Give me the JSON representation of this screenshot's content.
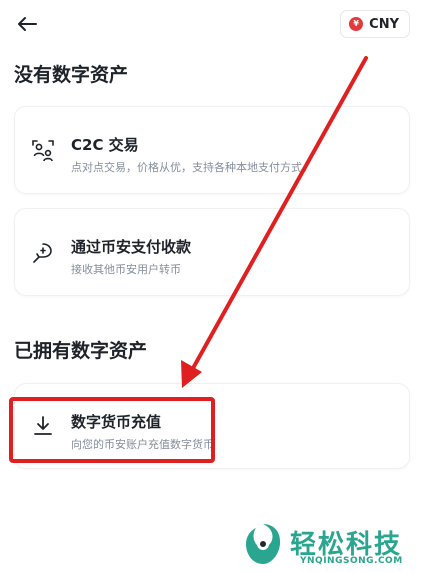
{
  "header": {
    "currency": {
      "flag_symbol": "¥",
      "code": "CNY"
    }
  },
  "sections": {
    "no_assets_title": "没有数字资产",
    "has_assets_title": "已拥有数字资产"
  },
  "cards": {
    "c2c": {
      "title": "C2C 交易",
      "desc": "点对点交易，价格从优，支持各种本地支付方式。",
      "icon": "user-exchange-icon"
    },
    "pay": {
      "title": "通过币安支付收款",
      "desc": "接收其他币安用户转币",
      "icon": "pay-receive-icon"
    },
    "deposit": {
      "title": "数字货币充值",
      "desc": "向您的币安账户充值数字货币",
      "icon": "download-icon"
    }
  },
  "annotation": {
    "color": "#e02020"
  },
  "watermark": {
    "brand": "轻松科技",
    "url": "YNQINGSONG.COM",
    "color": "#2aa58f"
  }
}
